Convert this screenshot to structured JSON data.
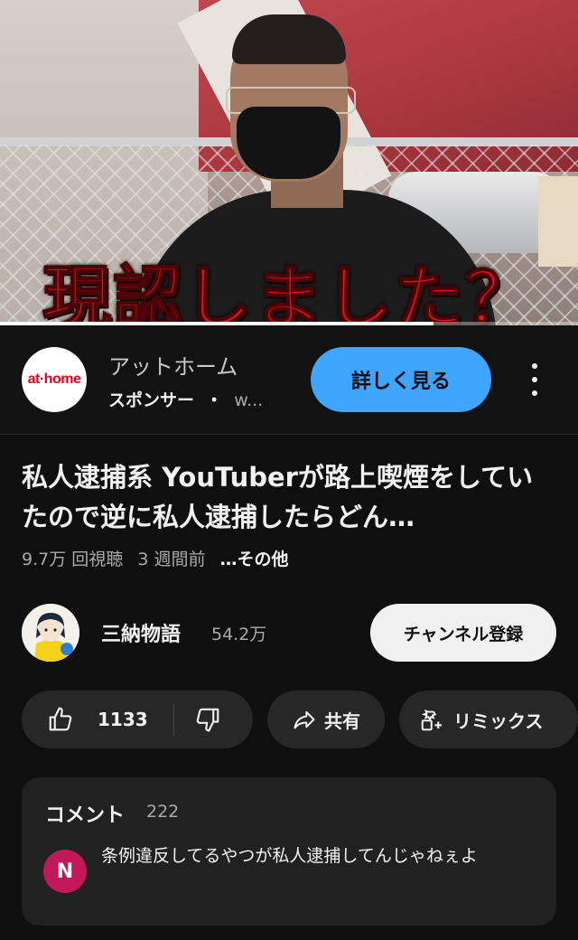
{
  "player": {
    "caption": "現認しました？",
    "progress_fraction": 0.75
  },
  "ad": {
    "logo_text": "at·home",
    "title": "アットホーム",
    "sponsor": "スポンサー",
    "separator": "・",
    "domain": "w...",
    "cta": "詳しく見る"
  },
  "video": {
    "title": "私人逮捕系 YouTuberが路上喫煙をしていたので逆に私人逮捕したらどん…",
    "views": "9.7万 回視聴",
    "age": "3 週間前",
    "more": "…その他"
  },
  "channel": {
    "name": "三納物語",
    "subscribers": "54.2万",
    "subscribe_label": "チャンネル登録"
  },
  "actions": {
    "like_count": "1133",
    "share_label": "共有",
    "remix_label": "リミックス"
  },
  "comments": {
    "heading": "コメント",
    "count": "222",
    "top_comment": {
      "avatar_letter": "N",
      "text": "条例違反してるやつが私人逮捕してんじゃねぇよ"
    }
  },
  "colors": {
    "background": "#0f0f0f",
    "cta_blue": "#3ea6ff",
    "caption_red": "#e0141e",
    "commenter_avatar": "#c2185b"
  }
}
